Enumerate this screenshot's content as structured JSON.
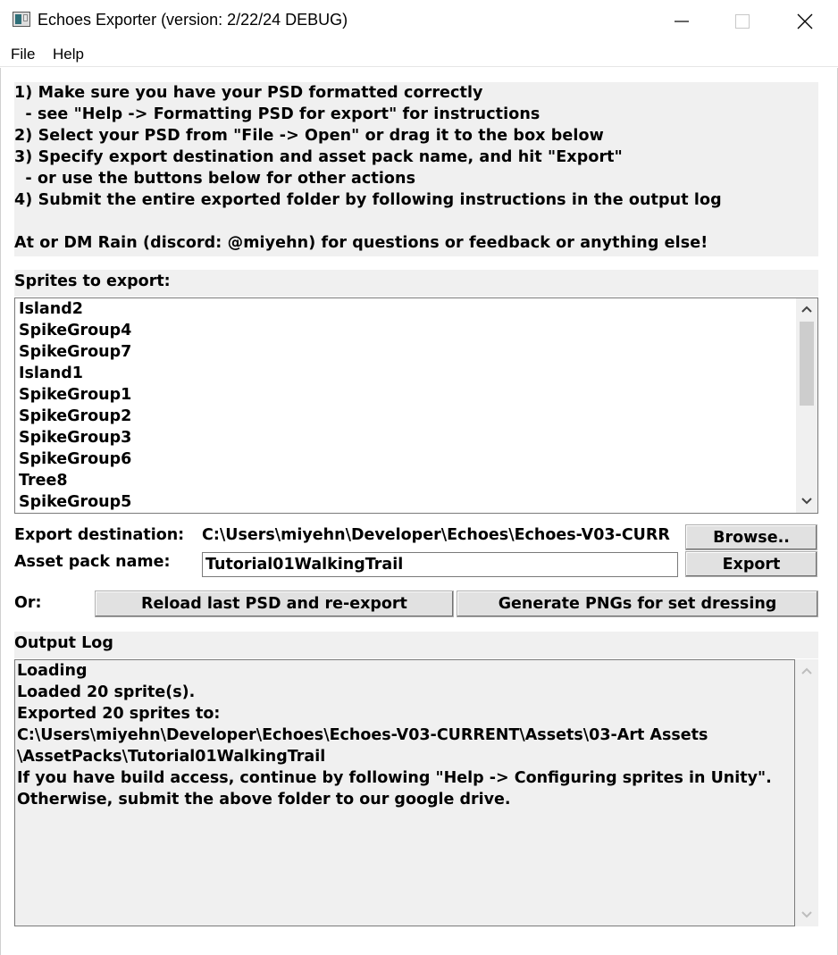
{
  "window": {
    "title": "Echoes Exporter (version: 2/22/24 DEBUG)",
    "icons": [
      "app-icon",
      "minimize-icon",
      "maximize-icon",
      "close-icon"
    ]
  },
  "menu": {
    "file": "File",
    "help": "Help"
  },
  "instructions": [
    "1) Make sure you have your PSD formatted correctly",
    "  - see \"Help -> Formatting PSD for export\" for instructions",
    "2) Select your PSD from \"File -> Open\" or drag it to the box below",
    "3) Specify export destination and asset pack name, and hit \"Export\"",
    "  - or use the buttons below for other actions",
    "4) Submit the entire exported folder by following instructions in the output log",
    "",
    "At or DM Rain (discord: @miyehn) for questions or feedback or anything else!"
  ],
  "sprites": {
    "label": "Sprites to export:",
    "items": [
      "Island2",
      "SpikeGroup4",
      "SpikeGroup7",
      "Island1",
      "SpikeGroup1",
      "SpikeGroup2",
      "SpikeGroup3",
      "SpikeGroup6",
      "Tree8",
      "SpikeGroup5"
    ]
  },
  "export": {
    "dest_label": "Export destination:",
    "dest_value": "C:\\Users\\miyehn\\Developer\\Echoes\\Echoes-V03-CURR",
    "browse_label": "Browse..",
    "pack_label": "Asset pack name:",
    "pack_value": "Tutorial01WalkingTrail",
    "export_label": "Export"
  },
  "actions": {
    "or_label": "Or:",
    "reload_label": "Reload last PSD and re-export",
    "generate_label": "Generate PNGs for set dressing"
  },
  "output": {
    "label": "Output Log",
    "lines": [
      "Loading",
      "Loaded 20 sprite(s).",
      "Exported 20 sprites to:",
      "C:\\Users\\miyehn\\Developer\\Echoes\\Echoes-V03-CURRENT\\Assets\\03-Art Assets",
      "\\AssetPacks\\Tutorial01WalkingTrail",
      "If you have build access, continue by following \"Help -> Configuring sprites in Unity\".",
      "Otherwise, submit the above folder to our google drive."
    ]
  }
}
